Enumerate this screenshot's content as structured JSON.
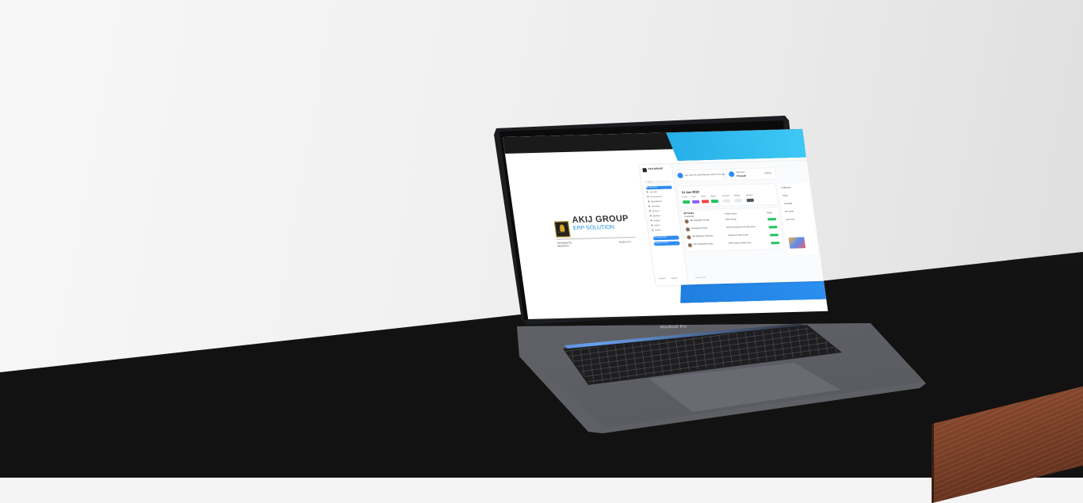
{
  "device": {
    "label": "MacBook Pro"
  },
  "brand": {
    "title": "AKIJ GROUP",
    "subtitle": "ERP SOLUTION",
    "developed_by": "Developed by IBOS/AKIJ",
    "version": "Version 2.0",
    "logo_text": "AKIJ GROUP"
  },
  "app": {
    "sidebar": {
      "brand": "AKIJ GROUP",
      "search_placeholder": "Search",
      "items": [
        "My Menu",
        "Account",
        "Procurement",
        "Manufacture",
        "Inventory",
        "Product",
        "Banking",
        "Budget",
        "Admin",
        "Others"
      ],
      "actions": [
        "ERP Application",
        "Business Report"
      ],
      "footer": [
        "Support",
        "Logout"
      ]
    },
    "cards": {
      "welcome": "Hey, User! Its Good Morning. Have a nice day.",
      "profile_label": "Welcome",
      "profile_name": "Prerealt",
      "extra": "Settings"
    },
    "date": {
      "value": "14 Jan 2020",
      "statuses": [
        "Present",
        "Leave",
        "Absent",
        "Holiday",
        "Movement",
        "Pending",
        "Approved"
      ]
    },
    "table": {
      "title": "All Tasks",
      "headers": [
        "Created By",
        "Project Name",
        "Status"
      ],
      "rows": [
        {
          "name": "MD Shahjalal Hossain",
          "project": "ERP Design",
          "status": "Complete"
        },
        {
          "name": "Shahadat Hossain",
          "project": "ERP Development for Akij Group",
          "status": "Complete"
        },
        {
          "name": "MD Mahbubur Rahman",
          "project": "Software Design Group",
          "status": "Complete"
        },
        {
          "name": "MD Shahadat Hossain",
          "project": "ERP Setup for Akij Group",
          "status": "Complete"
        }
      ]
    },
    "right_panel": [
      "Notification",
      "Today",
      "Yesterday",
      "This week",
      "Last week"
    ],
    "copyright": "Copyright 2020"
  },
  "colors": {
    "accent": "#2d8cf0",
    "cyan": "#25aee8",
    "success": "#22c55e",
    "logo_gold": "#d9a826"
  }
}
